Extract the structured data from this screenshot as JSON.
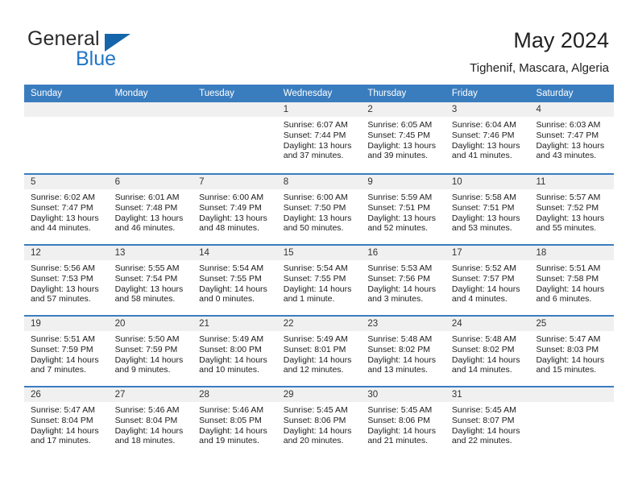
{
  "brand": {
    "name_top": "General",
    "name_bottom": "Blue",
    "accent_color": "#2176c7",
    "triangle_color": "#1565ab"
  },
  "header": {
    "title": "May 2024",
    "subtitle": "Tighenif, Mascara, Algeria"
  },
  "calendar": {
    "header_bg": "#3a7dbf",
    "daynum_bg": "#f0f0f0",
    "weekday_headers": [
      "Sunday",
      "Monday",
      "Tuesday",
      "Wednesday",
      "Thursday",
      "Friday",
      "Saturday"
    ],
    "weeks": [
      [
        {
          "day": "",
          "lines": []
        },
        {
          "day": "",
          "lines": []
        },
        {
          "day": "",
          "lines": []
        },
        {
          "day": "1",
          "lines": [
            "Sunrise: 6:07 AM",
            "Sunset: 7:44 PM",
            "Daylight: 13 hours",
            "and 37 minutes."
          ]
        },
        {
          "day": "2",
          "lines": [
            "Sunrise: 6:05 AM",
            "Sunset: 7:45 PM",
            "Daylight: 13 hours",
            "and 39 minutes."
          ]
        },
        {
          "day": "3",
          "lines": [
            "Sunrise: 6:04 AM",
            "Sunset: 7:46 PM",
            "Daylight: 13 hours",
            "and 41 minutes."
          ]
        },
        {
          "day": "4",
          "lines": [
            "Sunrise: 6:03 AM",
            "Sunset: 7:47 PM",
            "Daylight: 13 hours",
            "and 43 minutes."
          ]
        }
      ],
      [
        {
          "day": "5",
          "lines": [
            "Sunrise: 6:02 AM",
            "Sunset: 7:47 PM",
            "Daylight: 13 hours",
            "and 44 minutes."
          ]
        },
        {
          "day": "6",
          "lines": [
            "Sunrise: 6:01 AM",
            "Sunset: 7:48 PM",
            "Daylight: 13 hours",
            "and 46 minutes."
          ]
        },
        {
          "day": "7",
          "lines": [
            "Sunrise: 6:00 AM",
            "Sunset: 7:49 PM",
            "Daylight: 13 hours",
            "and 48 minutes."
          ]
        },
        {
          "day": "8",
          "lines": [
            "Sunrise: 6:00 AM",
            "Sunset: 7:50 PM",
            "Daylight: 13 hours",
            "and 50 minutes."
          ]
        },
        {
          "day": "9",
          "lines": [
            "Sunrise: 5:59 AM",
            "Sunset: 7:51 PM",
            "Daylight: 13 hours",
            "and 52 minutes."
          ]
        },
        {
          "day": "10",
          "lines": [
            "Sunrise: 5:58 AM",
            "Sunset: 7:51 PM",
            "Daylight: 13 hours",
            "and 53 minutes."
          ]
        },
        {
          "day": "11",
          "lines": [
            "Sunrise: 5:57 AM",
            "Sunset: 7:52 PM",
            "Daylight: 13 hours",
            "and 55 minutes."
          ]
        }
      ],
      [
        {
          "day": "12",
          "lines": [
            "Sunrise: 5:56 AM",
            "Sunset: 7:53 PM",
            "Daylight: 13 hours",
            "and 57 minutes."
          ]
        },
        {
          "day": "13",
          "lines": [
            "Sunrise: 5:55 AM",
            "Sunset: 7:54 PM",
            "Daylight: 13 hours",
            "and 58 minutes."
          ]
        },
        {
          "day": "14",
          "lines": [
            "Sunrise: 5:54 AM",
            "Sunset: 7:55 PM",
            "Daylight: 14 hours",
            "and 0 minutes."
          ]
        },
        {
          "day": "15",
          "lines": [
            "Sunrise: 5:54 AM",
            "Sunset: 7:55 PM",
            "Daylight: 14 hours",
            "and 1 minute."
          ]
        },
        {
          "day": "16",
          "lines": [
            "Sunrise: 5:53 AM",
            "Sunset: 7:56 PM",
            "Daylight: 14 hours",
            "and 3 minutes."
          ]
        },
        {
          "day": "17",
          "lines": [
            "Sunrise: 5:52 AM",
            "Sunset: 7:57 PM",
            "Daylight: 14 hours",
            "and 4 minutes."
          ]
        },
        {
          "day": "18",
          "lines": [
            "Sunrise: 5:51 AM",
            "Sunset: 7:58 PM",
            "Daylight: 14 hours",
            "and 6 minutes."
          ]
        }
      ],
      [
        {
          "day": "19",
          "lines": [
            "Sunrise: 5:51 AM",
            "Sunset: 7:59 PM",
            "Daylight: 14 hours",
            "and 7 minutes."
          ]
        },
        {
          "day": "20",
          "lines": [
            "Sunrise: 5:50 AM",
            "Sunset: 7:59 PM",
            "Daylight: 14 hours",
            "and 9 minutes."
          ]
        },
        {
          "day": "21",
          "lines": [
            "Sunrise: 5:49 AM",
            "Sunset: 8:00 PM",
            "Daylight: 14 hours",
            "and 10 minutes."
          ]
        },
        {
          "day": "22",
          "lines": [
            "Sunrise: 5:49 AM",
            "Sunset: 8:01 PM",
            "Daylight: 14 hours",
            "and 12 minutes."
          ]
        },
        {
          "day": "23",
          "lines": [
            "Sunrise: 5:48 AM",
            "Sunset: 8:02 PM",
            "Daylight: 14 hours",
            "and 13 minutes."
          ]
        },
        {
          "day": "24",
          "lines": [
            "Sunrise: 5:48 AM",
            "Sunset: 8:02 PM",
            "Daylight: 14 hours",
            "and 14 minutes."
          ]
        },
        {
          "day": "25",
          "lines": [
            "Sunrise: 5:47 AM",
            "Sunset: 8:03 PM",
            "Daylight: 14 hours",
            "and 15 minutes."
          ]
        }
      ],
      [
        {
          "day": "26",
          "lines": [
            "Sunrise: 5:47 AM",
            "Sunset: 8:04 PM",
            "Daylight: 14 hours",
            "and 17 minutes."
          ]
        },
        {
          "day": "27",
          "lines": [
            "Sunrise: 5:46 AM",
            "Sunset: 8:04 PM",
            "Daylight: 14 hours",
            "and 18 minutes."
          ]
        },
        {
          "day": "28",
          "lines": [
            "Sunrise: 5:46 AM",
            "Sunset: 8:05 PM",
            "Daylight: 14 hours",
            "and 19 minutes."
          ]
        },
        {
          "day": "29",
          "lines": [
            "Sunrise: 5:45 AM",
            "Sunset: 8:06 PM",
            "Daylight: 14 hours",
            "and 20 minutes."
          ]
        },
        {
          "day": "30",
          "lines": [
            "Sunrise: 5:45 AM",
            "Sunset: 8:06 PM",
            "Daylight: 14 hours",
            "and 21 minutes."
          ]
        },
        {
          "day": "31",
          "lines": [
            "Sunrise: 5:45 AM",
            "Sunset: 8:07 PM",
            "Daylight: 14 hours",
            "and 22 minutes."
          ]
        },
        {
          "day": "",
          "lines": []
        }
      ]
    ]
  }
}
